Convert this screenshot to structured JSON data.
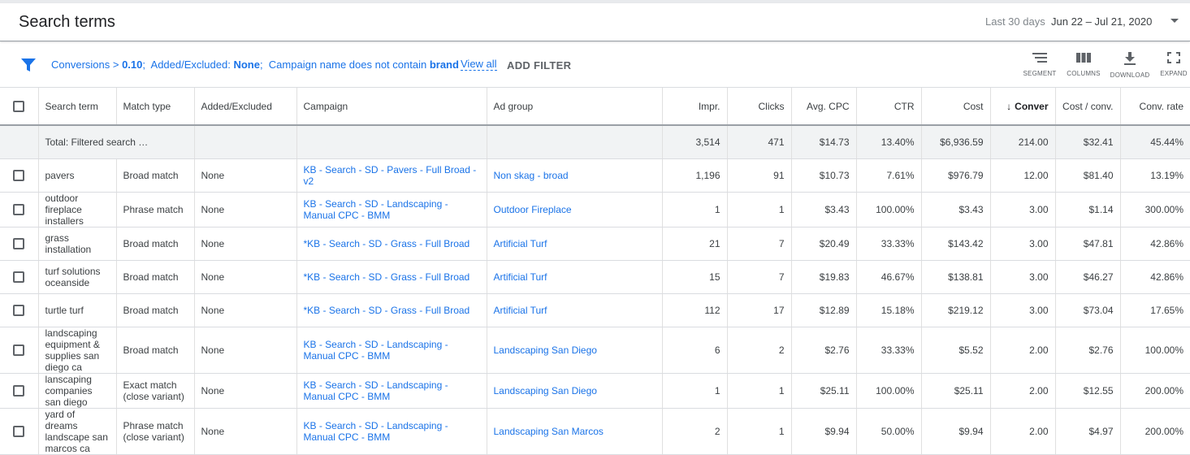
{
  "header": {
    "title": "Search terms",
    "date_label": "Last 30 days",
    "date_range": "Jun 22 – Jul 21, 2020"
  },
  "filters": {
    "f1_label": "Conversions > ",
    "f1_value": "0.10",
    "sep1": ";",
    "f2_label": "Added/Excluded: ",
    "f2_value": "None",
    "sep2": ";",
    "f3_label": "Campaign name does not contain ",
    "f3_value": "brand",
    "view_all": "View all",
    "add_filter": "ADD FILTER"
  },
  "toolbar": {
    "segment": "SEGMENT",
    "columns": "COLUMNS",
    "download": "DOWNLOAD",
    "expand": "EXPAND"
  },
  "columns": [
    "Search term",
    "Match type",
    "Added/Excluded",
    "Campaign",
    "Ad group",
    "Impr.",
    "Clicks",
    "Avg. CPC",
    "CTR",
    "Cost",
    "Conver",
    "Cost / conv.",
    "Conv. rate"
  ],
  "total": {
    "label": "Total: Filtered search …",
    "impr": "3,514",
    "clicks": "471",
    "avg_cpc": "$14.73",
    "ctr": "13.40%",
    "cost": "$6,936.59",
    "conv": "214.00",
    "cost_conv": "$32.41",
    "conv_rate": "45.44%"
  },
  "rows": [
    {
      "term": "pavers",
      "match": "Broad match",
      "added": "None",
      "campaign": "KB - Search - SD - Pavers - Full Broad - v2",
      "adgroup": "Non skag - broad",
      "impr": "1,196",
      "clicks": "91",
      "avg_cpc": "$10.73",
      "ctr": "7.61%",
      "cost": "$976.79",
      "conv": "12.00",
      "cost_conv": "$81.40",
      "conv_rate": "13.19%"
    },
    {
      "term": "outdoor fireplace installers",
      "match": "Phrase match",
      "added": "None",
      "campaign": "KB - Search - SD - Landscaping - Manual CPC - BMM",
      "adgroup": "Outdoor Fireplace",
      "impr": "1",
      "clicks": "1",
      "avg_cpc": "$3.43",
      "ctr": "100.00%",
      "cost": "$3.43",
      "conv": "3.00",
      "cost_conv": "$1.14",
      "conv_rate": "300.00%"
    },
    {
      "term": "grass installation",
      "match": "Broad match",
      "added": "None",
      "campaign": "*KB - Search - SD - Grass - Full Broad",
      "adgroup": "Artificial Turf",
      "impr": "21",
      "clicks": "7",
      "avg_cpc": "$20.49",
      "ctr": "33.33%",
      "cost": "$143.42",
      "conv": "3.00",
      "cost_conv": "$47.81",
      "conv_rate": "42.86%"
    },
    {
      "term": "turf solutions oceanside",
      "match": "Broad match",
      "added": "None",
      "campaign": "*KB - Search - SD - Grass - Full Broad",
      "adgroup": "Artificial Turf",
      "impr": "15",
      "clicks": "7",
      "avg_cpc": "$19.83",
      "ctr": "46.67%",
      "cost": "$138.81",
      "conv": "3.00",
      "cost_conv": "$46.27",
      "conv_rate": "42.86%"
    },
    {
      "term": "turtle turf",
      "match": "Broad match",
      "added": "None",
      "campaign": "*KB - Search - SD - Grass - Full Broad",
      "adgroup": "Artificial Turf",
      "impr": "112",
      "clicks": "17",
      "avg_cpc": "$12.89",
      "ctr": "15.18%",
      "cost": "$219.12",
      "conv": "3.00",
      "cost_conv": "$73.04",
      "conv_rate": "17.65%"
    },
    {
      "term": "landscaping equipment & supplies san diego ca",
      "match": "Broad match",
      "added": "None",
      "campaign": "KB - Search - SD - Landscaping - Manual CPC - BMM",
      "adgroup": "Landscaping San Diego",
      "impr": "6",
      "clicks": "2",
      "avg_cpc": "$2.76",
      "ctr": "33.33%",
      "cost": "$5.52",
      "conv": "2.00",
      "cost_conv": "$2.76",
      "conv_rate": "100.00%"
    },
    {
      "term": "lanscaping companies san diego",
      "match": "Exact match (close variant)",
      "added": "None",
      "campaign": "KB - Search - SD - Landscaping - Manual CPC - BMM",
      "adgroup": "Landscaping San Diego",
      "impr": "1",
      "clicks": "1",
      "avg_cpc": "$25.11",
      "ctr": "100.00%",
      "cost": "$25.11",
      "conv": "2.00",
      "cost_conv": "$12.55",
      "conv_rate": "200.00%"
    },
    {
      "term": "yard of dreams landscape san marcos ca",
      "match": "Phrase match (close variant)",
      "added": "None",
      "campaign": "KB - Search - SD - Landscaping - Manual CPC - BMM",
      "adgroup": "Landscaping San Marcos",
      "impr": "2",
      "clicks": "1",
      "avg_cpc": "$9.94",
      "ctr": "50.00%",
      "cost": "$9.94",
      "conv": "2.00",
      "cost_conv": "$4.97",
      "conv_rate": "200.00%"
    }
  ]
}
